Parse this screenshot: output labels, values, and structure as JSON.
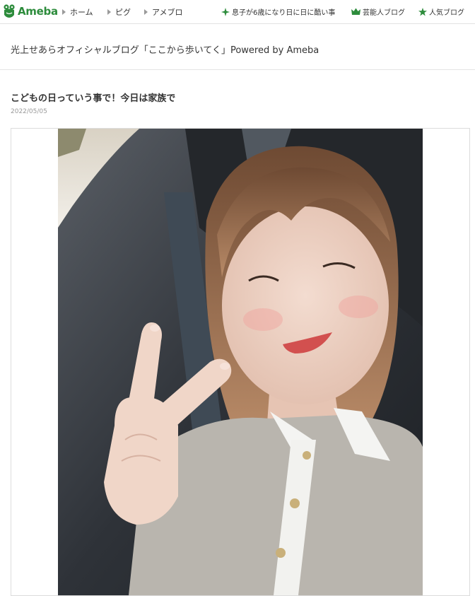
{
  "header": {
    "logo_text": "Ameba",
    "nav": {
      "home": "ホーム",
      "pigg": "ピグ",
      "ameblo": "アメブロ"
    },
    "right_links": {
      "news": "息子が6歳になり日に日に酷い事",
      "celeb_blog": "芸能人ブログ",
      "popular_blog": "人気ブログ"
    }
  },
  "blog": {
    "title": "光上せあらオフィシャルブログ「ここから歩いてく」Powered by Ameba"
  },
  "entry": {
    "title": "こどもの日っていう事で！今日は家族で",
    "date": "2022/05/05"
  },
  "colors": {
    "brand_green": "#2d8c3c",
    "border": "#e2e2e2",
    "date_gray": "#9a9a9a"
  },
  "icons": {
    "logo": "ameba-frog-icon",
    "nav_marker": "triangle-right-icon",
    "news": "green-sparkle-icon",
    "celeb": "crown-icon",
    "popular": "star-icon"
  }
}
